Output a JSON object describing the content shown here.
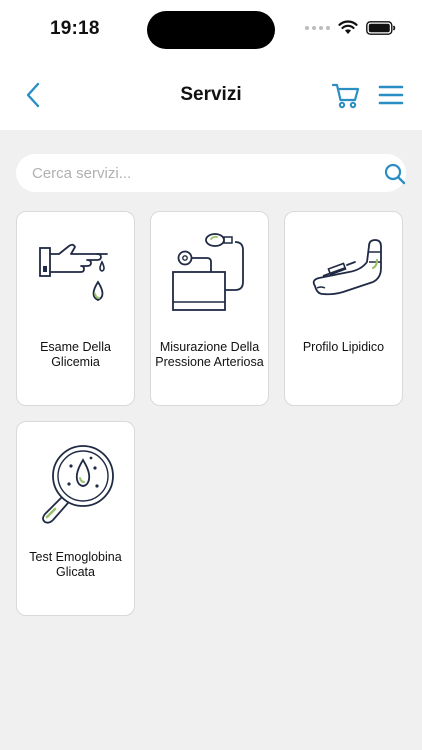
{
  "status_bar": {
    "time": "19:18"
  },
  "header": {
    "title": "Servizi"
  },
  "search": {
    "placeholder": "Cerca servizi..."
  },
  "services": [
    {
      "label": "Esame Della Glicemia",
      "icon": "finger-prick-icon"
    },
    {
      "label": "Misurazione Della Pressione Arteriosa",
      "icon": "blood-pressure-monitor-icon"
    },
    {
      "label": "Profilo Lipidico",
      "icon": "arm-injection-icon"
    },
    {
      "label": "Test Emoglobina Glicata",
      "icon": "magnifying-glass-blood-drop-icon"
    }
  ],
  "colors": {
    "accent": "#2a8ec4",
    "outline": "#1f2a44",
    "highlight": "#9ac26b",
    "background": "#f0f0f0"
  }
}
